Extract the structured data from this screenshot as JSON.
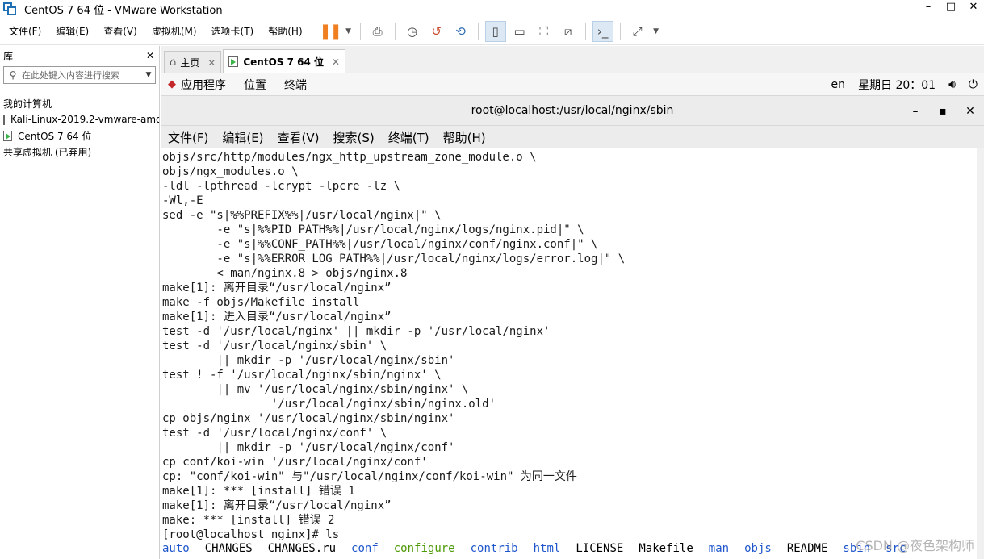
{
  "window": {
    "title": "CentOS 7 64 位 - VMware Workstation",
    "buttons": [
      "–",
      "□",
      "✕"
    ]
  },
  "menubar": {
    "items": [
      "文件(F)",
      "编辑(E)",
      "查看(V)",
      "虚拟机(M)",
      "选项卡(T)",
      "帮助(H)"
    ]
  },
  "library": {
    "title": "库",
    "close": "✕",
    "search_placeholder": "在此处键入内容进行搜索",
    "tree": [
      "我的计算机",
      "Kali-Linux-2019.2-vmware-amd64",
      "CentOS 7 64 位",
      "共享虚拟机 (已弃用)"
    ]
  },
  "tabs": [
    {
      "label": "主页",
      "close": "✕"
    },
    {
      "label": "CentOS 7 64 位",
      "close": "✕"
    }
  ],
  "gnome": {
    "apps": "应用程序",
    "places": "位置",
    "terminal": "终端",
    "lang": "en",
    "clock": "星期日 20：01"
  },
  "terminal": {
    "title": "root@localhost:/usr/local/nginx/sbin",
    "menu": [
      "文件(F)",
      "编辑(E)",
      "查看(V)",
      "搜索(S)",
      "终端(T)",
      "帮助(H)"
    ],
    "lines": [
      "objs/src/http/modules/ngx_http_upstream_zone_module.o \\",
      "objs/ngx_modules.o \\",
      "-ldl -lpthread -lcrypt -lpcre -lz \\",
      "-Wl,-E",
      "sed -e \"s|%%PREFIX%%|/usr/local/nginx|\" \\",
      "        -e \"s|%%PID_PATH%%|/usr/local/nginx/logs/nginx.pid|\" \\",
      "        -e \"s|%%CONF_PATH%%|/usr/local/nginx/conf/nginx.conf|\" \\",
      "        -e \"s|%%ERROR_LOG_PATH%%|/usr/local/nginx/logs/error.log|\" \\",
      "        < man/nginx.8 > objs/nginx.8",
      "make[1]: 离开目录“/usr/local/nginx”",
      "make -f objs/Makefile install",
      "make[1]: 进入目录“/usr/local/nginx”",
      "test -d '/usr/local/nginx' || mkdir -p '/usr/local/nginx'",
      "test -d '/usr/local/nginx/sbin' \\",
      "        || mkdir -p '/usr/local/nginx/sbin'",
      "test ! -f '/usr/local/nginx/sbin/nginx' \\",
      "        || mv '/usr/local/nginx/sbin/nginx' \\",
      "                '/usr/local/nginx/sbin/nginx.old'",
      "cp objs/nginx '/usr/local/nginx/sbin/nginx'",
      "test -d '/usr/local/nginx/conf' \\",
      "        || mkdir -p '/usr/local/nginx/conf'",
      "cp conf/koi-win '/usr/local/nginx/conf'",
      "cp: \"conf/koi-win\" 与\"/usr/local/nginx/conf/koi-win\" 为同一文件",
      "make[1]: *** [install] 错误 1",
      "make[1]: 离开目录“/usr/local/nginx”",
      "make: *** [install] 错误 2",
      "[root@localhost nginx]# ls"
    ],
    "ls_output": [
      {
        "name": "auto",
        "color": "blue"
      },
      {
        "name": "CHANGES",
        "color": "normal"
      },
      {
        "name": "CHANGES.ru",
        "color": "normal"
      },
      {
        "name": "conf",
        "color": "blue"
      },
      {
        "name": "configure",
        "color": "green"
      },
      {
        "name": "contrib",
        "color": "blue"
      },
      {
        "name": "html",
        "color": "blue"
      },
      {
        "name": "LICENSE",
        "color": "normal"
      },
      {
        "name": "Makefile",
        "color": "normal"
      },
      {
        "name": "man",
        "color": "blue"
      },
      {
        "name": "objs",
        "color": "blue"
      },
      {
        "name": "README",
        "color": "normal"
      },
      {
        "name": "sbin",
        "color": "blue"
      },
      {
        "name": "src",
        "color": "blue"
      }
    ]
  },
  "watermark": "CSDN @夜色架构师"
}
